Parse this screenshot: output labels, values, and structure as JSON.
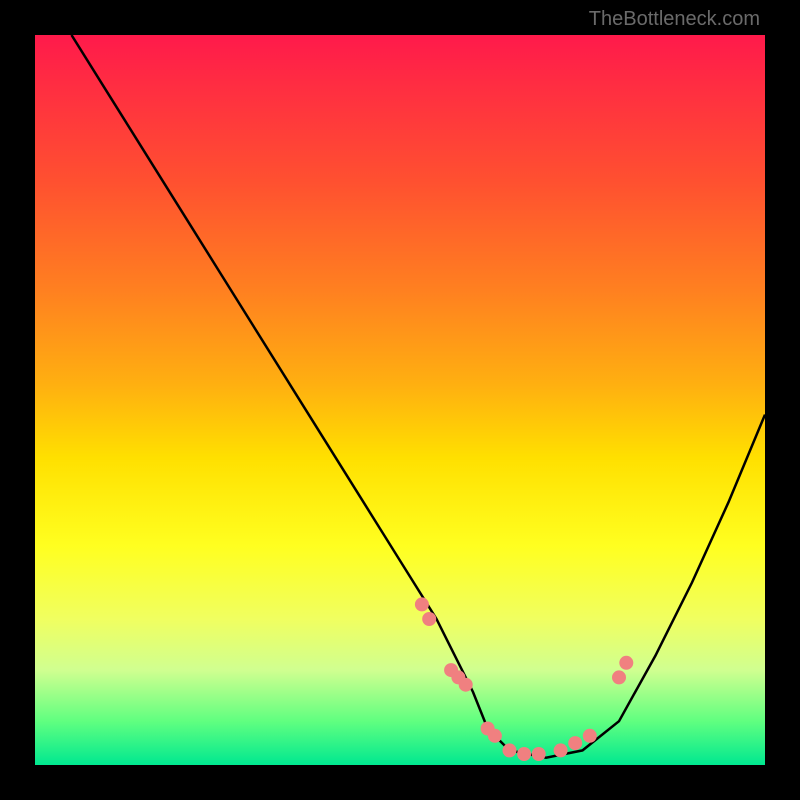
{
  "watermark": "TheBottleneck.com",
  "chart_data": {
    "type": "line",
    "title": "",
    "xlabel": "",
    "ylabel": "",
    "x_range": [
      0,
      100
    ],
    "y_range": [
      0,
      100
    ],
    "series": [
      {
        "name": "bottleneck-curve",
        "color": "#000000",
        "x": [
          5,
          10,
          15,
          20,
          25,
          30,
          35,
          40,
          45,
          50,
          55,
          60,
          62,
          65,
          70,
          75,
          80,
          85,
          90,
          95,
          100
        ],
        "values": [
          100,
          92,
          84,
          76,
          68,
          60,
          52,
          44,
          36,
          28,
          20,
          10,
          5,
          2,
          1,
          2,
          6,
          15,
          25,
          36,
          48
        ]
      }
    ],
    "scatter_points": {
      "name": "data-points",
      "color": "#f08080",
      "size": 7,
      "x": [
        53,
        54,
        57,
        58,
        59,
        62,
        63,
        65,
        67,
        69,
        72,
        74,
        76,
        80,
        81
      ],
      "y": [
        22,
        20,
        13,
        12,
        11,
        5,
        4,
        2,
        1.5,
        1.5,
        2,
        3,
        4,
        12,
        14
      ]
    }
  }
}
